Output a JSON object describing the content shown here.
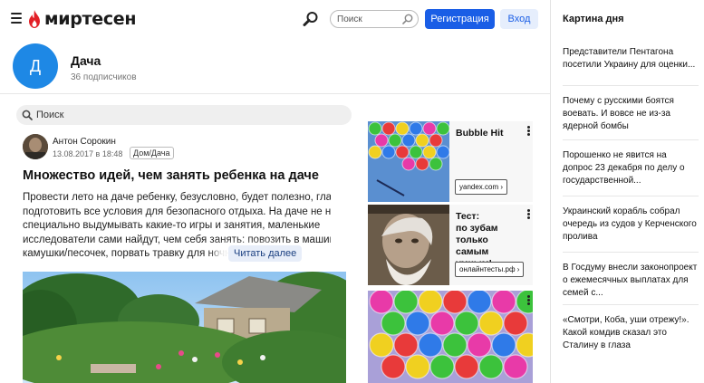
{
  "header": {
    "logo_text": "миртесен",
    "search_placeholder": "Поиск",
    "register_label": "Регистрация",
    "login_label": "Вход",
    "colors": {
      "brand": "#e21f26",
      "primary": "#1a5ee6"
    }
  },
  "group": {
    "avatar_letter": "Д",
    "title": "Дача",
    "subscribers": "36 подписчиков",
    "avatar_color": "#1e88e5"
  },
  "page_search": {
    "placeholder": "Поиск"
  },
  "post": {
    "author": "Антон Сорокин",
    "date": "13.08.2017 в 18:48",
    "tag": "Дом/Дача",
    "title": "Множество идей, чем занять ребенка на даче",
    "excerpt_lines": [
      "Провести лето на даче ребенку, безусловно, будет полезно, главное",
      "подготовить все условия для безопасного отдыха. На даче не нужно",
      "специально выдумывать какие-то игры и занятия, маленькие",
      "исследователи сами найдут, чем себя занять: повозить в машине",
      "камушки/песочек, порвать травку для ночны"
    ],
    "read_more": "Читать далее"
  },
  "ads": [
    {
      "title": "Bubble Hit",
      "domain": "yandex.com ›"
    },
    {
      "title": "Тест: по зубам только самым умным!",
      "title_lines": [
        "Тест:",
        "по зубам",
        "только самым",
        "умным!"
      ],
      "domain": "онлайнтесты.рф ›"
    }
  ],
  "sidebar": {
    "title": "Картина дня",
    "items": [
      "Представители Пентагона посетили Украину для оценки...",
      "Почему с русскими боятся воевать. И вовсе не из-за ядерной бомбы",
      "Порошенко не явится на допрос 23 декабря по делу о государственной...",
      "Украинский корабль собрал очередь из судов у Керченского пролива",
      "В Госдуму внесли законопроект о ежемесячных выплатах для семей с...",
      "«Смотри, Коба, уши отрежу!». Какой комдив сказал это Сталину в глаза"
    ]
  }
}
